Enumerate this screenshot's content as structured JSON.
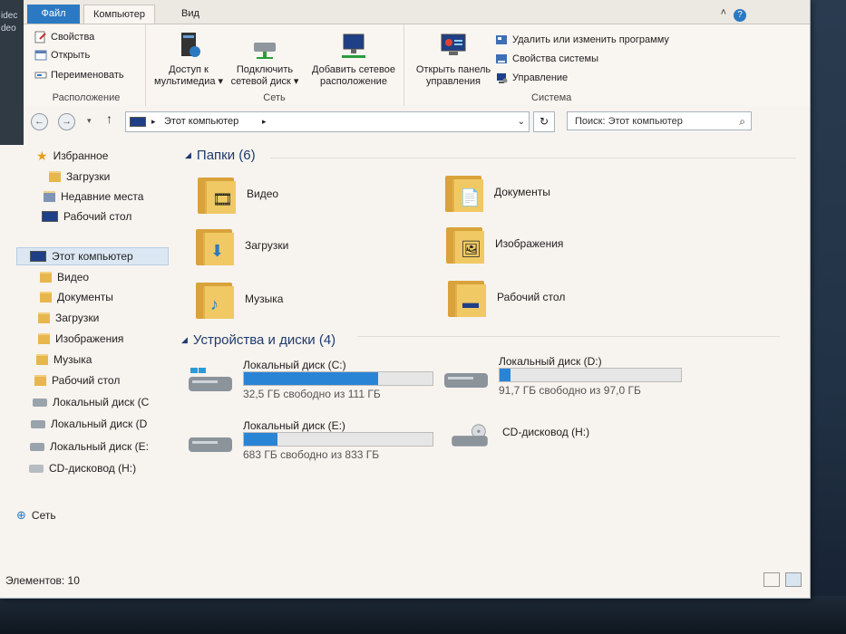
{
  "desktop": {
    "left_texts": [
      "idec",
      "deo"
    ]
  },
  "ribbon_tabs": {
    "file": "Файл",
    "computer": "Компьютер",
    "view": "Вид",
    "help": "?"
  },
  "ribbon": {
    "location_group": {
      "label": "Расположение",
      "properties": "Свойства",
      "open": "Открыть",
      "rename": "Переименовать"
    },
    "network_group": {
      "label": "Сеть",
      "media_access": [
        "Доступ к",
        "мультимедиа"
      ],
      "map_drive": [
        "Подключить",
        "сетевой диск"
      ],
      "add_location": [
        "Добавить сетевое",
        "расположение"
      ]
    },
    "system_group": {
      "label": "Система",
      "control_panel": [
        "Открыть панель",
        "управления"
      ],
      "uninstall": "Удалить или изменить программу",
      "system_props": "Свойства системы",
      "manage": "Управление"
    }
  },
  "address": {
    "path": "Этот компьютер",
    "search_placeholder": "Поиск: Этот компьютер"
  },
  "navpane": {
    "favorites": "Избранное",
    "downloads": "Загрузки",
    "recent": "Недавние места",
    "desktop": "Рабочий стол",
    "this_pc": "Этот компьютер",
    "video": "Видео",
    "documents": "Документы",
    "downloads2": "Загрузки",
    "images": "Изображения",
    "music": "Музыка",
    "desktop2": "Рабочий стол",
    "disk_c": "Локальный диск (C",
    "disk_d": "Локальный диск (D",
    "disk_e": "Локальный диск (E:",
    "cd": "CD-дисковод (H:)",
    "network": "Сеть"
  },
  "folders": {
    "header": "Папки (6)",
    "items": [
      "Видео",
      "Документы",
      "Загрузки",
      "Изображения",
      "Музыка",
      "Рабочий стол"
    ]
  },
  "devices": {
    "header": "Устройства и диски (4)",
    "drives": [
      {
        "name": "Локальный диск (C:)",
        "free": "32,5 ГБ свободно из 111 ГБ",
        "used_fraction": 0.71
      },
      {
        "name": "Локальный диск (D:)",
        "free": "91,7 ГБ свободно из 97,0 ГБ",
        "used_fraction": 0.06
      },
      {
        "name": "Локальный диск (E:)",
        "free": "683 ГБ свободно из 833 ГБ",
        "used_fraction": 0.18
      }
    ],
    "cd": "CD-дисковод (H:)"
  },
  "status": {
    "count": "Элементов: 10"
  },
  "colors": {
    "accent": "#2b79c2",
    "drive_fill": "#2a84d6"
  }
}
